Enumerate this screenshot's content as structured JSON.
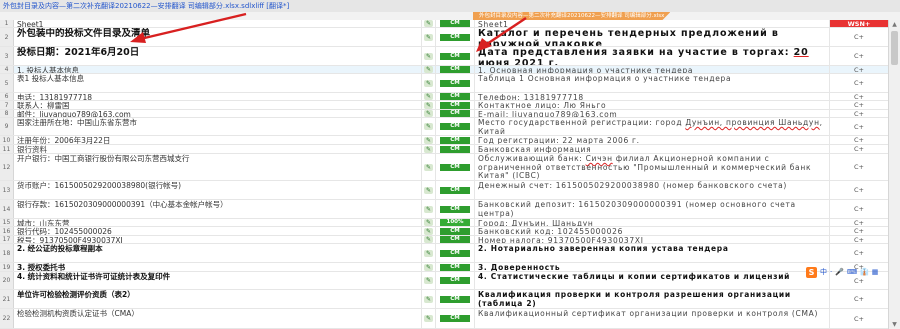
{
  "window": {
    "title": "外包封目录及内容—第二次补充翻译20210622—安排翻译 司编辑部分.xlsx.sdlxliff [翻译*]",
    "file_tab": "外包封目录及内容—第二次补充翻译20210622—安排翻译 司编辑部分.xlsx"
  },
  "status_labels": {
    "cm": "CM",
    "pct": "100%"
  },
  "wsn_badge": "WSN+",
  "rows": [
    {
      "num": "1",
      "src": "Sheet1",
      "tgt": "Sheet1",
      "status": "CM",
      "c": "WSN+"
    },
    {
      "num": "2",
      "src": "外包装中的投标文件目录及清单",
      "tgt": "Каталог и перечень тендерных предложений в наружной упаковке",
      "status": "CM",
      "c": "C+"
    },
    {
      "num": "3",
      "src": "投标日期：2021年6月20日",
      "tgt_pre": "Дата представления заявки на участие в торгах: ",
      "tgt_mark": "20 июня 2021 г.",
      "status": "CM",
      "c": "C+"
    },
    {
      "num": "4",
      "src": "1. 投标人基本信息",
      "tgt": "1. Основная информация о участнике тендера",
      "status": "CM",
      "c": "C+"
    },
    {
      "num": "5",
      "src": "表1  投标人基本信息",
      "tgt": "Таблица 1 Основная информация о участнике тендера",
      "status": "CM",
      "c": "C+"
    },
    {
      "num": "6",
      "src": "电话：13181977718",
      "tgt": "Телефон: 13181977718",
      "status": "CM",
      "c": "C+"
    },
    {
      "num": "7",
      "src": "联系人：柳雷国",
      "tgt_pre": "Контактное лицо: ",
      "tgt_mark": "Лю Яньго",
      "status": "CM",
      "c": "C+"
    },
    {
      "num": "8",
      "src": "邮件：liuyanguo789@163.com",
      "tgt": "E-mail: liuyanguo789@163.com",
      "status": "CM",
      "c": "C+"
    },
    {
      "num": "9",
      "src": "国家注册所在地：中国山东省东营市",
      "tgt_pre": "Место государственной регистрации: город ",
      "tgt_mark": "Дунъин, провинция Шаньдун",
      "tgt_post": ", Китай",
      "status": "CM",
      "c": "C+"
    },
    {
      "num": "10",
      "src": "注册年份：2006年3月22日",
      "tgt": "Год регистрации: 22 марта 2006 г.",
      "status": "CM",
      "c": "C+"
    },
    {
      "num": "11",
      "src": "银行资料",
      "tgt": "Банковская информация",
      "status": "CM",
      "c": "C+"
    },
    {
      "num": "12",
      "src": "开户银行：中国工商银行股份有限公司东营西城支行",
      "tgt_pre": "Обслуживающий банк: ",
      "tgt_mark": "Сичэн",
      "tgt_post": " филиал Акционерной компании с ограниченной ответственностью \"Промышленный и коммерческий банк Китая\" (ICBC)",
      "status": "CM",
      "c": "C+"
    },
    {
      "num": "13",
      "src": "货币账户：1615005029200038980(银行帐号)",
      "tgt": "Денежный счет: 1615005029200038980 (номер банковского счета)",
      "status": "CM",
      "c": "C+"
    },
    {
      "num": "14",
      "src": "银行存款：1615020309000000391（中心基本金帐户帐号）",
      "tgt": "Банковский депозит: 1615020309000000391 (номер основного счета центра)",
      "status": "CM",
      "c": "C+"
    },
    {
      "num": "15",
      "src": "城市：山东东营",
      "tgt_pre": "Город: ",
      "tgt_mark": "Дунъин, Шаньдун",
      "status": "100%",
      "c": "C+"
    },
    {
      "num": "16",
      "src": "银行代码：102455000026",
      "tgt": "Банковский код: 102455000026",
      "status": "CM",
      "c": "C+"
    },
    {
      "num": "17",
      "src": "税号：91370500F4930037XJ",
      "tgt": "Номер налога: 91370500F4930037XJ",
      "status": "CM",
      "c": "C+"
    },
    {
      "num": "18",
      "src": "2. 经公证的投标章程副本",
      "tgt": "2. Нотариально заверенная копия устава тендера",
      "status": "CM",
      "c": "C+"
    },
    {
      "num": "19",
      "src": "3. 授权委托书",
      "tgt": "3. Доверенность",
      "status": "CM",
      "c": "C+"
    },
    {
      "num": "20",
      "src": "4. 统计资料和统计证书许可证统计表及复印件",
      "tgt": "4. Статистические таблицы и копии сертификатов и лицензий",
      "status": "CM",
      "c": "C+"
    },
    {
      "num": "21",
      "src": "单位许可检验检测评价资质（表2）",
      "tgt": "Квалификация проверки и контроля разрешения организации (таблица 2)",
      "status": "CM",
      "c": "C+"
    },
    {
      "num": "22",
      "src": "检验检测机构资质认定证书（CMA）",
      "tgt": "Квалификационный сертификат организации проверки и контроля (CMA)",
      "status": "CM",
      "c": "C+"
    }
  ],
  "ime": {
    "chars": [
      "中",
      "·",
      "🎤",
      "⌨",
      "👔",
      "▦"
    ]
  }
}
